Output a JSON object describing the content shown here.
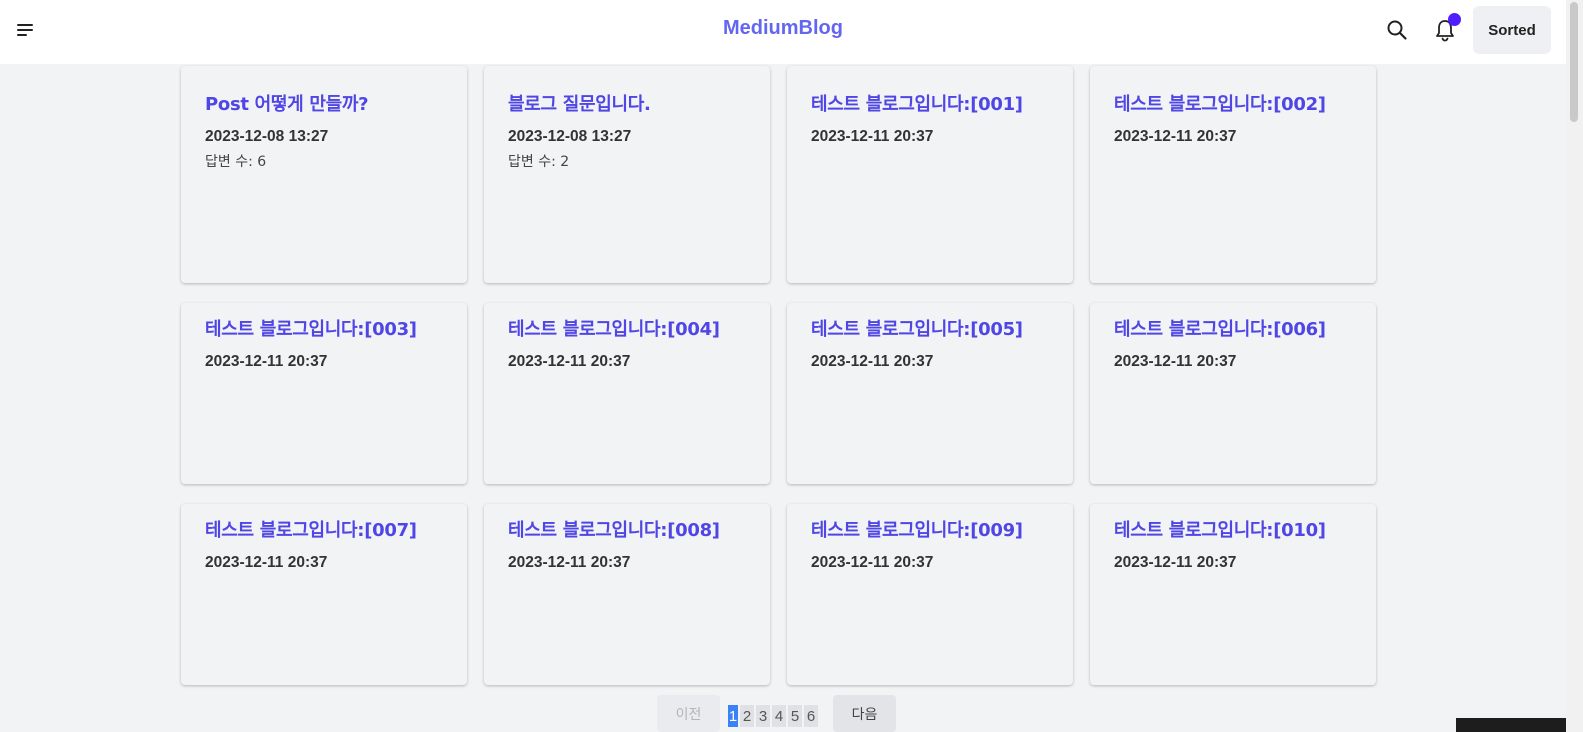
{
  "header": {
    "brand": "MediumBlog",
    "sorted_label": "Sorted"
  },
  "icons": {
    "menu": "menu-icon",
    "search": "search-icon",
    "bell": "bell-icon"
  },
  "colors": {
    "brand": "#6366f1",
    "title": "#4f46e5",
    "notification_dot": "#4f1dff",
    "active_page": "#3b82f6"
  },
  "posts": [
    {
      "title": "Post 어떻게 만들까?",
      "date": "2023-12-08 13:27",
      "answers": "답변 수: 6"
    },
    {
      "title": "블로그 질문입니다.",
      "date": "2023-12-08 13:27",
      "answers": "답변 수: 2"
    },
    {
      "title": "테스트 블로그입니다:[001]",
      "date": "2023-12-11 20:37"
    },
    {
      "title": "테스트 블로그입니다:[002]",
      "date": "2023-12-11 20:37"
    },
    {
      "title": "테스트 블로그입니다:[003]",
      "date": "2023-12-11 20:37"
    },
    {
      "title": "테스트 블로그입니다:[004]",
      "date": "2023-12-11 20:37"
    },
    {
      "title": "테스트 블로그입니다:[005]",
      "date": "2023-12-11 20:37"
    },
    {
      "title": "테스트 블로그입니다:[006]",
      "date": "2023-12-11 20:37"
    },
    {
      "title": "테스트 블로그입니다:[007]",
      "date": "2023-12-11 20:37"
    },
    {
      "title": "테스트 블로그입니다:[008]",
      "date": "2023-12-11 20:37"
    },
    {
      "title": "테스트 블로그입니다:[009]",
      "date": "2023-12-11 20:37"
    },
    {
      "title": "테스트 블로그입니다:[010]",
      "date": "2023-12-11 20:37"
    }
  ],
  "pagination": {
    "prev_label": "이전",
    "next_label": "다음",
    "pages": [
      "1",
      "2",
      "3",
      "4",
      "5",
      "6"
    ],
    "current": "1"
  }
}
